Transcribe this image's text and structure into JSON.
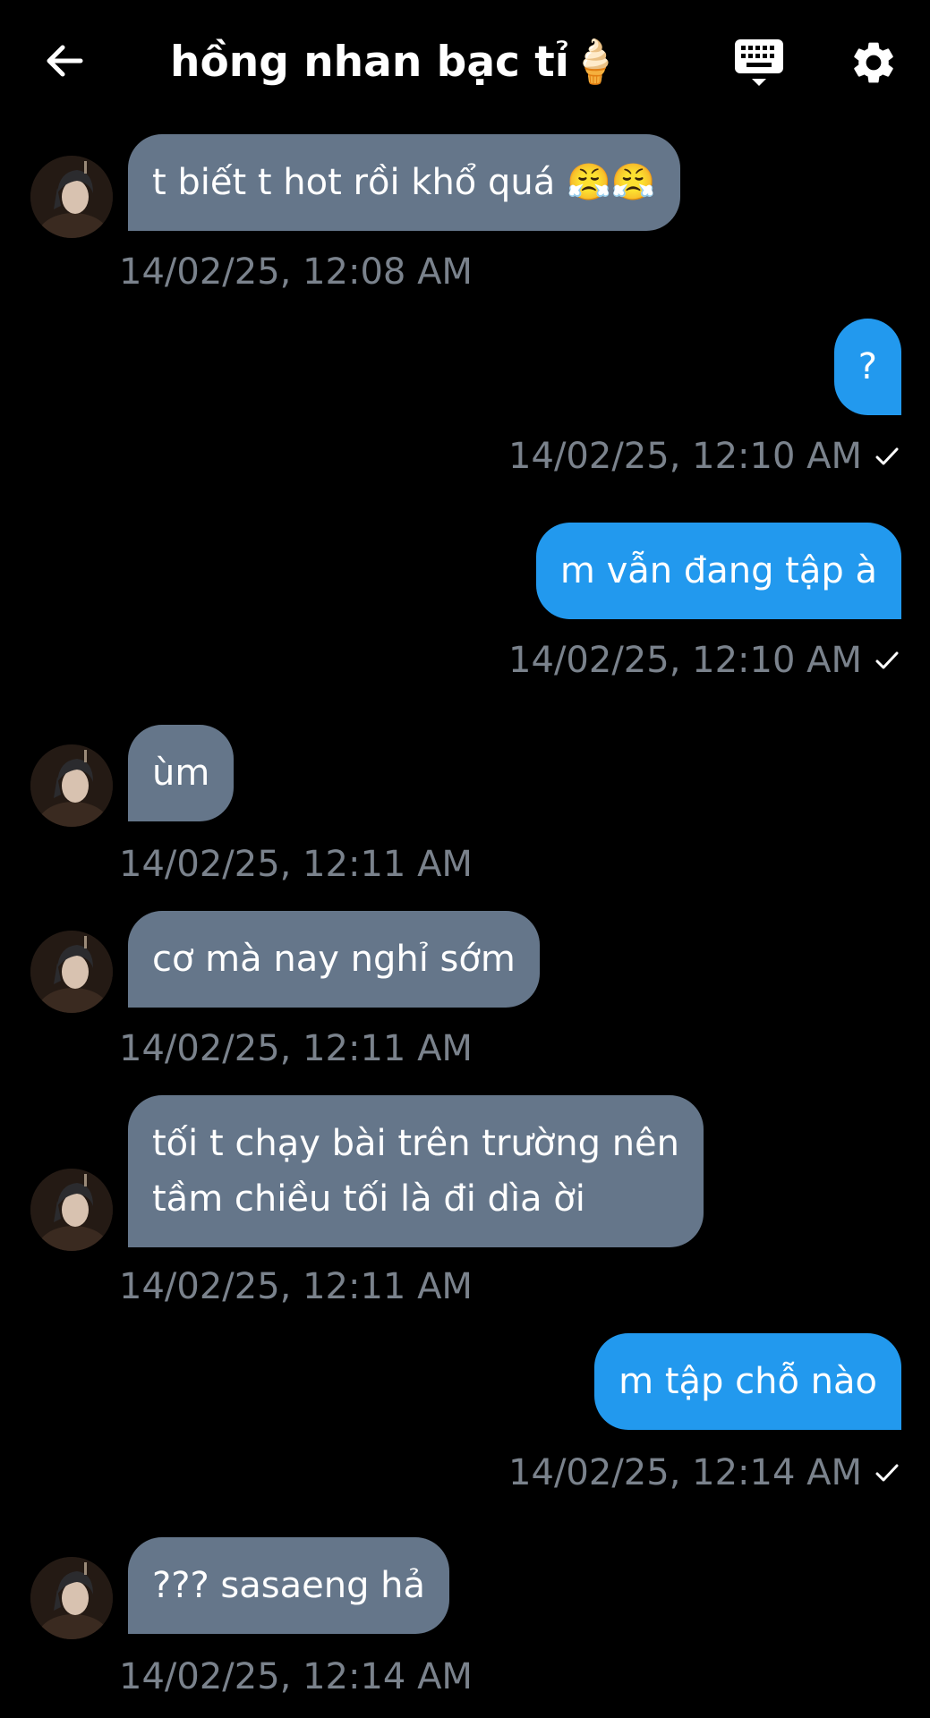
{
  "header": {
    "title": "hồng nhan bạc tỉ🍦",
    "back_icon": "arrow-left-icon",
    "keyboard_icon": "keyboard-icon",
    "settings_icon": "gear-icon"
  },
  "colors": {
    "background": "#000000",
    "incoming_bubble": "#65768a",
    "outgoing_bubble": "#2299ee",
    "timestamp": "#7a828c"
  },
  "messages": [
    {
      "direction": "in",
      "lines": [
        "t biết t hot rồi khổ quá 😤😤"
      ],
      "time": "14/02/25, 12:08 AM"
    },
    {
      "direction": "out",
      "lines": [
        "?"
      ],
      "time": "14/02/25, 12:10 AM",
      "read": true
    },
    {
      "direction": "out",
      "lines": [
        "m vẫn đang tập à"
      ],
      "time": "14/02/25, 12:10 AM",
      "read": true
    },
    {
      "direction": "in",
      "lines": [
        "ùm"
      ],
      "time": "14/02/25, 12:11 AM"
    },
    {
      "direction": "in",
      "lines": [
        "cơ mà nay nghỉ sớm"
      ],
      "time": "14/02/25, 12:11 AM"
    },
    {
      "direction": "in",
      "lines": [
        "tối t chạy bài trên trường nên",
        "tầm chiều tối là đi dìa ời"
      ],
      "time": "14/02/25, 12:11 AM"
    },
    {
      "direction": "out",
      "lines": [
        "m tập chỗ nào"
      ],
      "time": "14/02/25, 12:14 AM",
      "read": true
    },
    {
      "direction": "in",
      "lines": [
        "??? sasaeng hả"
      ],
      "time": "14/02/25, 12:14 AM"
    }
  ]
}
